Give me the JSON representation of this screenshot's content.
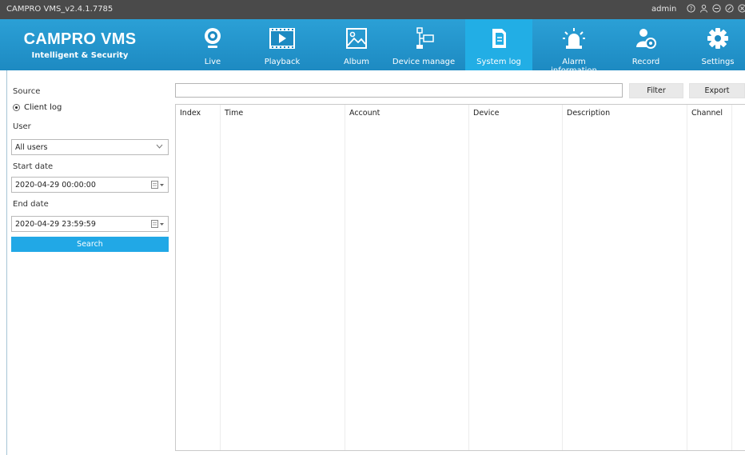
{
  "window": {
    "title": "CAMPRO VMS_v2.4.1.7785",
    "user": "admin",
    "controls": [
      "help-icon",
      "user-icon",
      "minimize-icon",
      "restore-icon",
      "close-icon"
    ]
  },
  "brand": {
    "name": "CAMPRO VMS",
    "tagline": "Intelligent & Security"
  },
  "nav": [
    {
      "label": "Live",
      "icon": "webcam-icon"
    },
    {
      "label": "Playback",
      "icon": "film-play-icon"
    },
    {
      "label": "Album",
      "icon": "picture-icon"
    },
    {
      "label": "Device manage",
      "icon": "device-tree-icon"
    },
    {
      "label": "System log",
      "icon": "document-icon",
      "active": true
    },
    {
      "label": "Alarm information",
      "icon": "alarm-light-icon"
    },
    {
      "label": "Record",
      "icon": "user-camera-icon"
    },
    {
      "label": "Settings",
      "icon": "gear-icon"
    }
  ],
  "filters": {
    "source_label": "Source",
    "source_option": "Client log",
    "user_label": "User",
    "user_value": "All users",
    "start_label": "Start date",
    "start_value": "2020-04-29 00:00:00",
    "end_label": "End date",
    "end_value": "2020-04-29 23:59:59",
    "search_button": "Search"
  },
  "toolbar": {
    "filter_value": "",
    "filter_button": "Filter",
    "export_button": "Export"
  },
  "table": {
    "columns": [
      "Index",
      "Time",
      "Account",
      "Device",
      "Description",
      "Channel"
    ],
    "rows": []
  },
  "colors": {
    "titlebar": "#4a4a4a",
    "banner": "#1f93cc",
    "active_tab": "#22aee5",
    "search_button": "#21a8e6"
  }
}
